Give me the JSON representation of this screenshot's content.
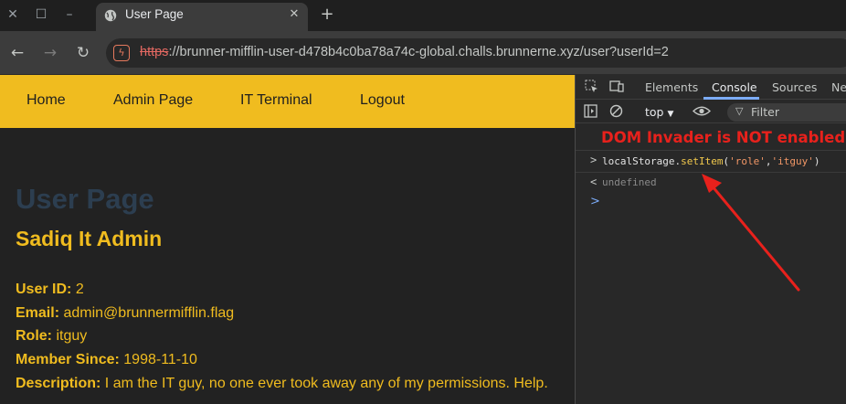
{
  "browser": {
    "tab_title": "User Page",
    "url_scheme": "https",
    "url_rest": "://brunner-mifflin-user-d478b4c0ba78a74c-global.challs.brunnerne.xyz/user?userId=2",
    "icons": {
      "close": "close-icon",
      "restore": "restore-icon",
      "minimize": "minimize-icon",
      "globe": "globe-icon",
      "new_tab": "plus-icon",
      "back": "back-arrow-icon",
      "forward": "forward-arrow-icon",
      "reload": "reload-icon"
    }
  },
  "page": {
    "nav": [
      "Home",
      "Admin Page",
      "IT Terminal",
      "Logout"
    ],
    "title": "User Page",
    "user_name": "Sadiq It Admin",
    "fields": {
      "user_id_label": "User ID:",
      "user_id": "2",
      "email_label": "Email:",
      "email": "admin@brunnermifflin.flag",
      "role_label": "Role:",
      "role": "itguy",
      "member_label": "Member Since:",
      "member": "1998-11-10",
      "desc_label": "Description:",
      "desc": "I am the IT guy, no one ever took away any of my permissions. Help."
    },
    "colors": {
      "nav_bg": "#f0bc1f",
      "accent": "#f0bc1f",
      "title": "#2c3e50",
      "bg": "#222222"
    }
  },
  "devtools": {
    "tabs": [
      "Elements",
      "Console",
      "Sources",
      "Network"
    ],
    "active_tab": "Console",
    "context": "top",
    "filter_placeholder": "Filter",
    "dom_invader_message": "DOM Invader is NOT enabled.",
    "console": {
      "input_prefix": ">",
      "input_obj": "localStorage.",
      "input_fn": "setItem",
      "input_open": "(",
      "input_arg1": "'role'",
      "input_comma": ",",
      "input_arg2": "'itguy'",
      "input_close": ")",
      "output_prefix": "<",
      "output": "undefined",
      "prompt": ">"
    }
  }
}
